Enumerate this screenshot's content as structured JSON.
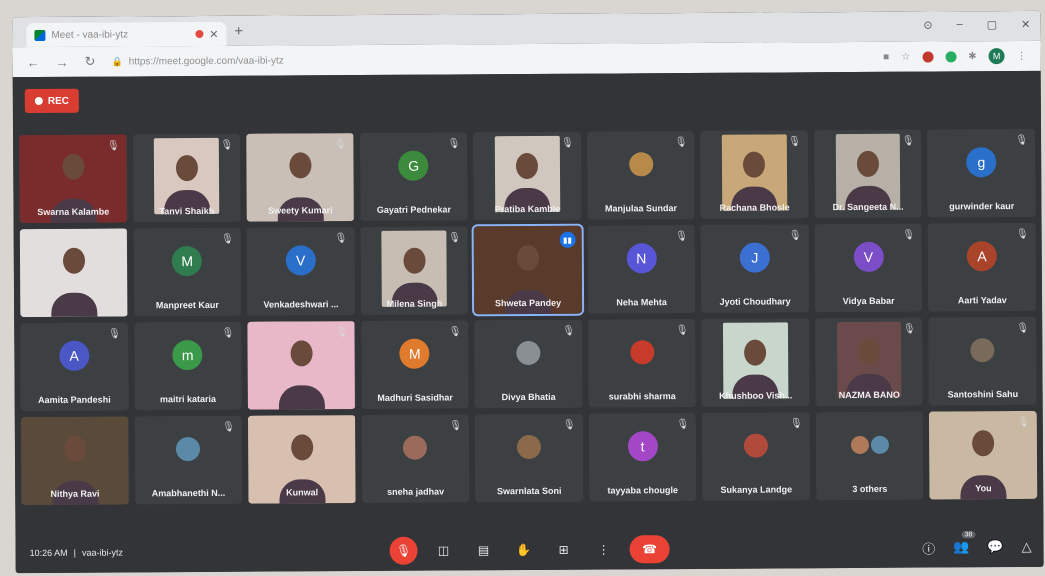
{
  "browser": {
    "tab_title": "Meet - vaa-ibi-ytz",
    "new_tab": "+",
    "url": "https://meet.google.com/vaa-ibi-ytz",
    "window_controls": [
      "⊙",
      "–",
      "▢",
      "✕"
    ],
    "account_initial": "M"
  },
  "meet": {
    "rec_label": "REC",
    "time": "10:26 AM",
    "meeting_code": "vaa-ibi-ytz",
    "participants_count": "38",
    "tiles": [
      {
        "name": "Swarna Kalambe",
        "kind": "video",
        "color": "#7a2b2b",
        "muted": true
      },
      {
        "name": "Tanvi Shaikh",
        "kind": "video",
        "color": "#d8c8c0",
        "muted": true
      },
      {
        "name": "Sweety Kumari",
        "kind": "video",
        "color": "#c9bfb6",
        "muted": true
      },
      {
        "name": "Gayatri Pednekar",
        "kind": "avatar",
        "initial": "G",
        "color": "#3c8a3c",
        "muted": true
      },
      {
        "name": "Pratiba Kamble",
        "kind": "video",
        "color": "#d0c7bf",
        "muted": true
      },
      {
        "name": "Manjulaa Sundar",
        "kind": "photo",
        "color": "#b88a4a",
        "muted": true
      },
      {
        "name": "Rachana Bhosle",
        "kind": "video",
        "color": "#c8a878",
        "muted": true
      },
      {
        "name": "Dr. Sangeeta N...",
        "kind": "video",
        "color": "#b7b0a6",
        "muted": true
      },
      {
        "name": "gurwinder kaur",
        "kind": "avatar",
        "initial": "g",
        "color": "#2a6fc9",
        "muted": true
      },
      {
        "name": "",
        "kind": "video",
        "color": "#e3dede",
        "muted": false
      },
      {
        "name": "Manpreet Kaur",
        "kind": "avatar",
        "initial": "M",
        "color": "#2f7d4f",
        "muted": true
      },
      {
        "name": "Venkadeshwari ...",
        "kind": "avatar",
        "initial": "V",
        "color": "#2a6fc9",
        "muted": true
      },
      {
        "name": "Milena Singh",
        "kind": "video",
        "color": "#c8bdb3",
        "muted": true
      },
      {
        "name": "Shweta Pandey",
        "kind": "video",
        "color": "#5a3a2a",
        "muted": false,
        "speaking": true
      },
      {
        "name": "Neha Mehta",
        "kind": "avatar",
        "initial": "N",
        "color": "#5856d6",
        "muted": true
      },
      {
        "name": "Jyoti Choudhary",
        "kind": "avatar",
        "initial": "J",
        "color": "#3b6fd1",
        "muted": true
      },
      {
        "name": "Vidya Babar",
        "kind": "avatar",
        "initial": "V",
        "color": "#7b4ec8",
        "muted": true
      },
      {
        "name": "Aarti Yadav",
        "kind": "avatar",
        "initial": "A",
        "color": "#a9442a",
        "muted": true
      },
      {
        "name": "Aamita Pandeshi",
        "kind": "avatar",
        "initial": "A",
        "color": "#4b57c4",
        "muted": true
      },
      {
        "name": "maitri kataria",
        "kind": "avatar",
        "initial": "m",
        "color": "#3a9a4a",
        "muted": true
      },
      {
        "name": "",
        "kind": "video",
        "color": "#e8b8c8",
        "muted": true
      },
      {
        "name": "Madhuri Sasidhar",
        "kind": "avatar",
        "initial": "M",
        "color": "#e07a2c",
        "muted": true
      },
      {
        "name": "Divya Bhatia",
        "kind": "photo",
        "color": "#8a8f94",
        "muted": true
      },
      {
        "name": "surabhi sharma",
        "kind": "photo",
        "color": "#c83a2a",
        "muted": true
      },
      {
        "name": "Khushboo Vish...",
        "kind": "video",
        "color": "#c9d6cc",
        "muted": false
      },
      {
        "name": "NAZMA BANO",
        "kind": "video",
        "color": "#6a4a4a",
        "muted": true
      },
      {
        "name": "Santoshini Sahu",
        "kind": "photo",
        "color": "#7a6a5a",
        "muted": true
      },
      {
        "name": "Nithya Ravi",
        "kind": "video",
        "color": "#5a4a3a",
        "muted": false
      },
      {
        "name": "Amabhanethi N...",
        "kind": "photo",
        "color": "#5a8aa8",
        "muted": true
      },
      {
        "name": "Kunwal",
        "kind": "video",
        "color": "#d8c0b0",
        "muted": false
      },
      {
        "name": "sneha jadhav",
        "kind": "photo",
        "color": "#9a6a5a",
        "muted": true
      },
      {
        "name": "Swarnlata Soni",
        "kind": "photo",
        "color": "#8a6a4a",
        "muted": true
      },
      {
        "name": "tayyaba chougle",
        "kind": "avatar",
        "initial": "t",
        "color": "#a347c7",
        "muted": true
      },
      {
        "name": "Sukanya Landge",
        "kind": "photo",
        "color": "#b04a3a",
        "muted": true
      },
      {
        "name": "3 others",
        "kind": "others",
        "color": "#888",
        "muted": false
      },
      {
        "name": "You",
        "kind": "video",
        "color": "#c9b9a2",
        "muted": true
      }
    ],
    "icons": {
      "mic": "🎙",
      "camera": "◫",
      "captions": "▤",
      "hand": "✋",
      "present": "⊞",
      "more": "⋮",
      "end": "☎",
      "info": "ⓘ",
      "people": "👥",
      "chat": "💬",
      "activities": "△"
    }
  }
}
